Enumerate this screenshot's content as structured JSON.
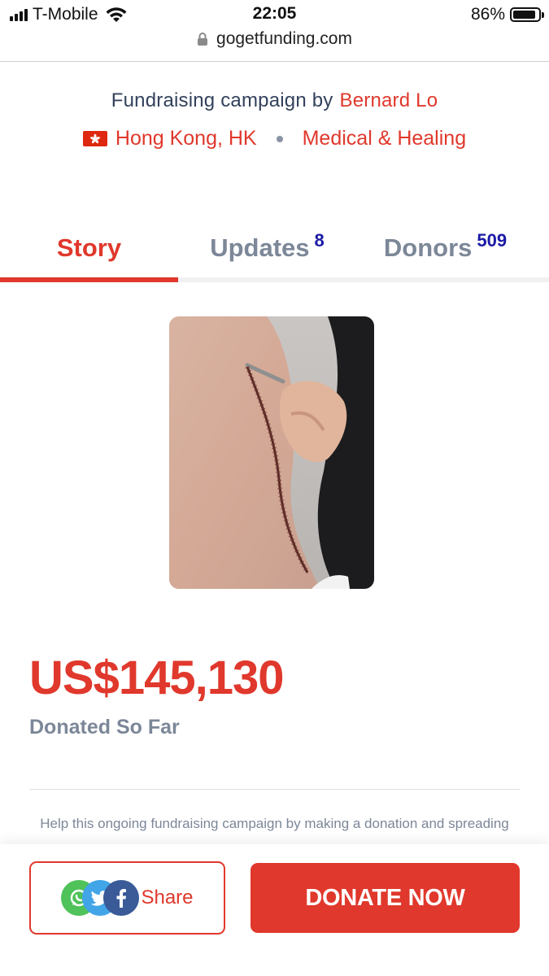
{
  "status_bar": {
    "carrier": "T-Mobile",
    "time": "22:05",
    "battery_percent": "86%"
  },
  "browser": {
    "url": "gogetfunding.com"
  },
  "campaign": {
    "by_label": "Fundraising campaign by",
    "author": "Bernard Lo",
    "location": "Hong Kong, HK",
    "category": "Medical & Healing"
  },
  "tabs": [
    {
      "label": "Story",
      "count": ""
    },
    {
      "label": "Updates",
      "count": "8"
    },
    {
      "label": "Donors",
      "count": "509"
    }
  ],
  "fundraising": {
    "amount": "US$145,130",
    "amount_label": "Donated So Far",
    "help_text": "Help this ongoing fundraising campaign by making a donation and spreading"
  },
  "actions": {
    "share_label": "Share",
    "donate_label": "DONATE NOW"
  },
  "colors": {
    "accent": "#e0382c",
    "muted": "#7c8798",
    "badge": "#1a1aa6"
  }
}
